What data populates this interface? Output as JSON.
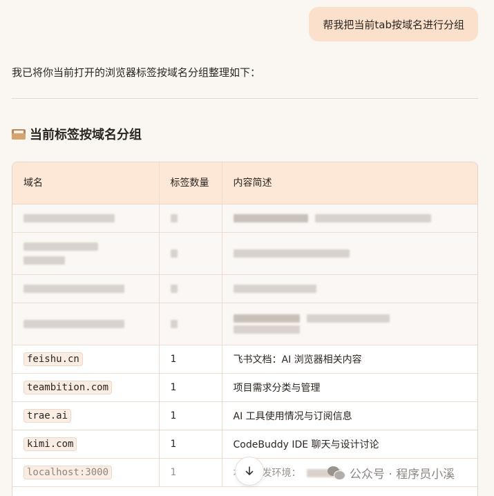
{
  "user_message": "帮我把当前tab按域名进行分组",
  "assistant": {
    "intro": "我已将你当前打开的浏览器标签按域名分组整理如下：",
    "heading": "当前标签按域名分组",
    "heading_icon": "folder-icon"
  },
  "table": {
    "headers": [
      "域名",
      "标签数量",
      "内容简述"
    ],
    "rows": [
      {
        "domain": "feishu.cn",
        "count": "1",
        "desc": "飞书文档：AI 浏览器相关内容"
      },
      {
        "domain": "teambition.com",
        "count": "1",
        "desc": "项目需求分类与管理"
      },
      {
        "domain": "trae.ai",
        "count": "1",
        "desc": "AI 工具使用情况与订阅信息"
      },
      {
        "domain": "kimi.com",
        "count": "1",
        "desc": "CodeBuddy IDE 聊天与设计讨论"
      },
      {
        "domain": "localhost:3000",
        "count": "1",
        "desc": "本地开发环境："
      }
    ]
  },
  "scroll_button_icon": "arrow-down-icon",
  "watermark": {
    "icon": "wechat-icon",
    "text": "公众号 · 程序员小溪"
  },
  "colors": {
    "background": "#faf6f1",
    "user_bubble": "#fbe0cc",
    "table_header": "#fde7d6"
  }
}
